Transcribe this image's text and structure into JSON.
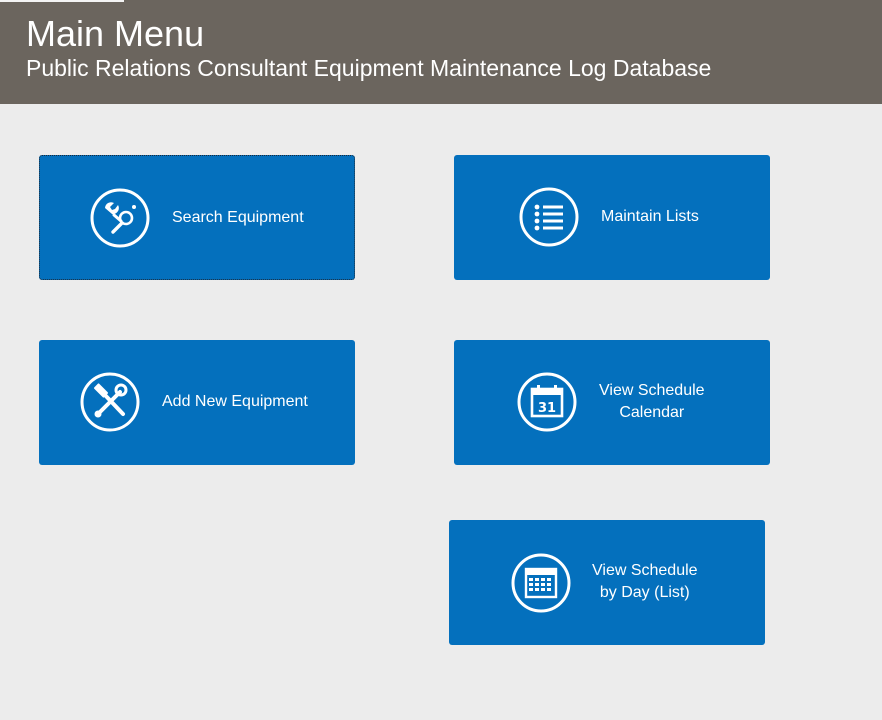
{
  "header": {
    "title": "Main Menu",
    "subtitle": "Public Relations Consultant Equipment Maintenance Log Database"
  },
  "tiles": {
    "search_equipment": {
      "label": "Search Equipment",
      "icon": "search-tools-icon"
    },
    "maintain_lists": {
      "label": "Maintain Lists",
      "icon": "list-icon"
    },
    "add_new_equipment": {
      "label": "Add New Equipment",
      "icon": "wrench-hammer-icon"
    },
    "view_schedule_calendar": {
      "line1": "View Schedule",
      "line2": "Calendar",
      "icon": "calendar-31-icon"
    },
    "view_schedule_list": {
      "line1": "View Schedule",
      "line2": "by Day (List)",
      "icon": "calendar-grid-icon"
    }
  },
  "colors": {
    "header_bg": "#6b655e",
    "page_bg": "#ececec",
    "tile_bg": "#0470bd",
    "text_light": "#ffffff"
  }
}
